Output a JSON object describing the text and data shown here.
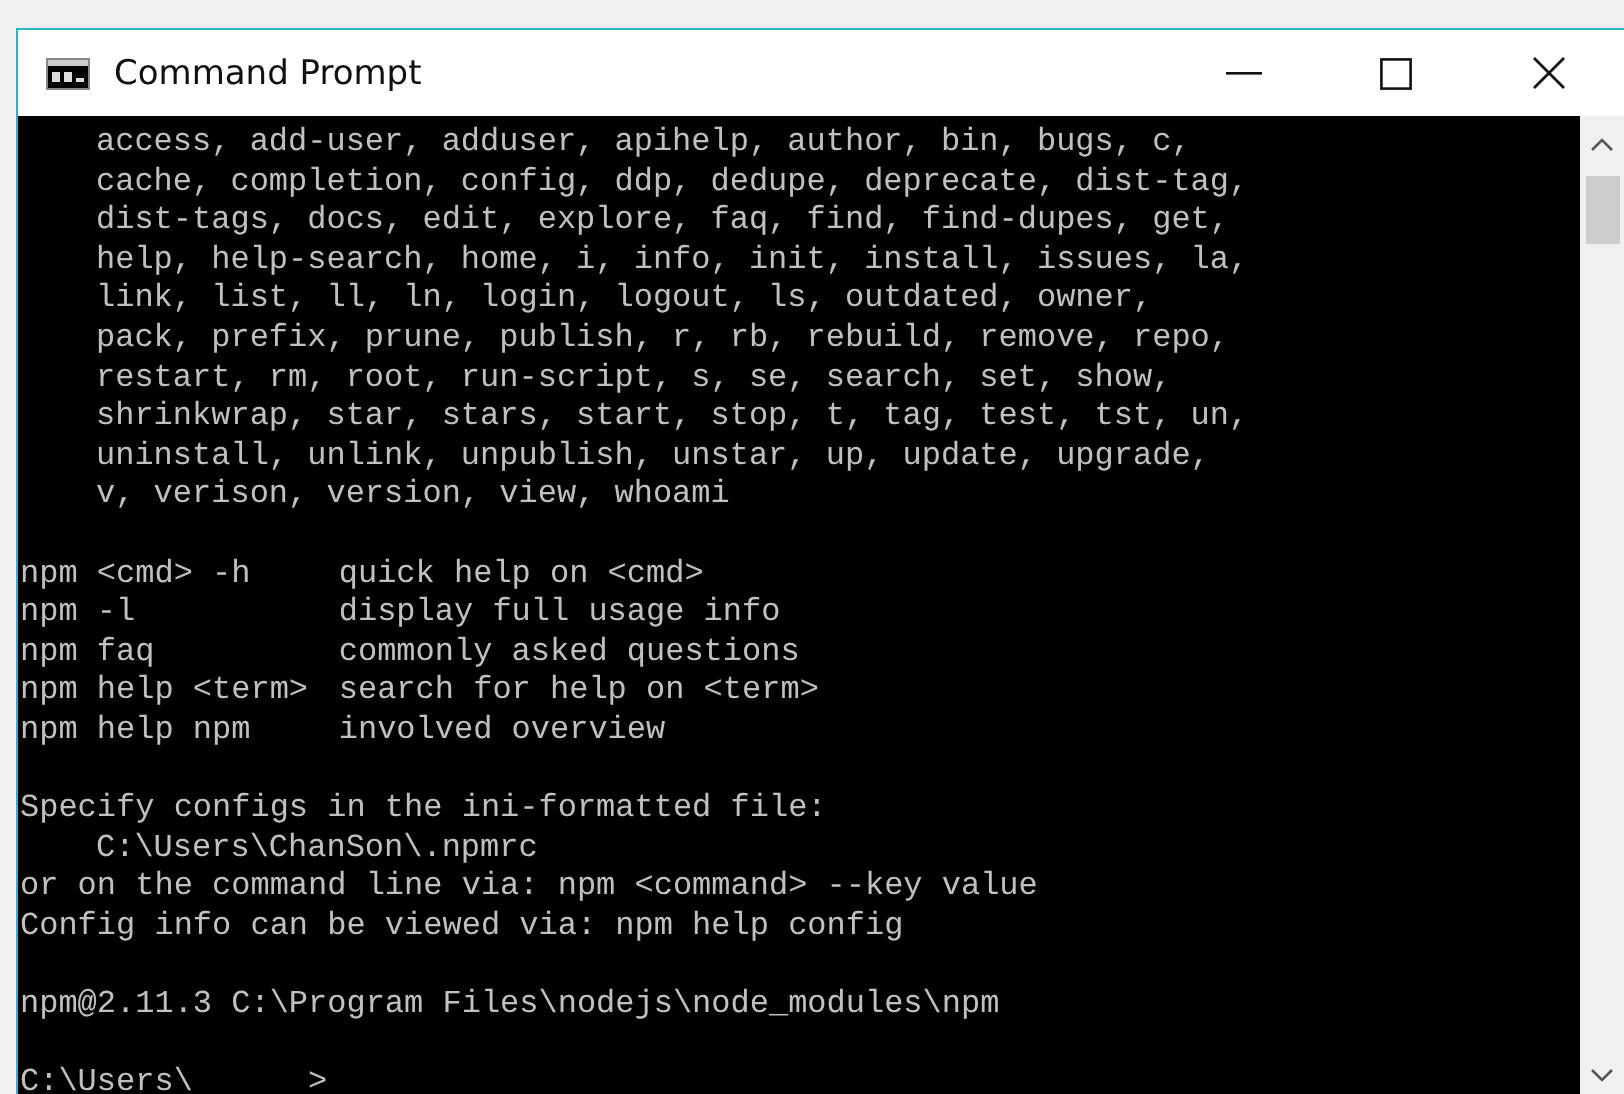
{
  "window": {
    "title": "Command Prompt"
  },
  "terminal": {
    "command_list": [
      "access, add-user, adduser, apihelp, author, bin, bugs, c,",
      "cache, completion, config, ddp, dedupe, deprecate, dist-tag,",
      "dist-tags, docs, edit, explore, faq, find, find-dupes, get,",
      "help, help-search, home, i, info, init, install, issues, la,",
      "link, list, ll, ln, login, logout, ls, outdated, owner,",
      "pack, prefix, prune, publish, r, rb, rebuild, remove, repo,",
      "restart, rm, root, run-script, s, se, search, set, show,",
      "shrinkwrap, star, stars, start, stop, t, tag, test, tst, un,",
      "uninstall, unlink, unpublish, unstar, up, update, upgrade,",
      "v, verison, version, view, whoami"
    ],
    "help_table": [
      {
        "command": "npm <cmd> -h",
        "description": "quick help on <cmd>"
      },
      {
        "command": "npm -l",
        "description": "display full usage info"
      },
      {
        "command": "npm faq",
        "description": "commonly asked questions"
      },
      {
        "command": "npm help <term>",
        "description": "search for help on <term>"
      },
      {
        "command": "npm help npm",
        "description": "involved overview"
      }
    ],
    "config_info": {
      "heading": "Specify configs in the ini-formatted file:",
      "file_path": "C:\\Users\\ChanSon\\.npmrc",
      "lines": [
        "or on the command line via: npm <command> --key value",
        "Config info can be viewed via: npm help config"
      ]
    },
    "version_line": "npm@2.11.3 C:\\Program Files\\nodejs\\node_modules\\npm",
    "prompt": "C:\\Users\\      >"
  }
}
